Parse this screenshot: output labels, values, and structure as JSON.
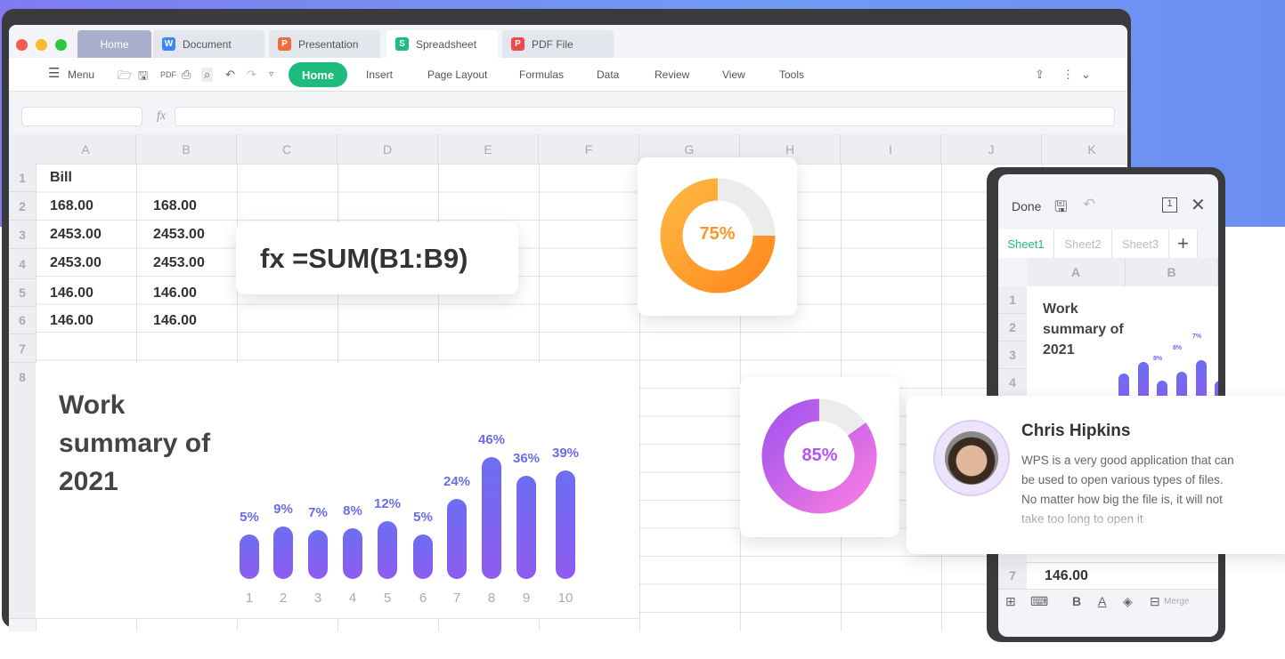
{
  "window": {
    "tabs": [
      {
        "label": "Home",
        "icon": ""
      },
      {
        "label": "Document",
        "icon": "W",
        "color": "#3f86f5"
      },
      {
        "label": "Presentation",
        "icon": "P",
        "color": "#f26b3a"
      },
      {
        "label": "Spreadsheet",
        "icon": "S",
        "color": "#1dbb7c"
      },
      {
        "label": "PDF File",
        "icon": "P",
        "color": "#ef4a4a"
      }
    ],
    "active_tab": "Spreadsheet"
  },
  "toolbar": {
    "menu_label": "Menu",
    "ribbon": [
      "Home",
      "Insert",
      "Page Layout",
      "Formulas",
      "Data",
      "Review",
      "View",
      "Tools"
    ],
    "active": "Home",
    "accent": "#1dbb7c"
  },
  "formula_bar": {
    "fx_label": "fx",
    "name_box": "",
    "value": ""
  },
  "sheet": {
    "columns": [
      "A",
      "B",
      "C",
      "D",
      "E",
      "F",
      "G",
      "H",
      "I",
      "J",
      "K"
    ],
    "rows": [
      "1",
      "2",
      "3",
      "4",
      "5",
      "6",
      "7",
      "8"
    ],
    "cells": [
      [
        "Bill",
        ""
      ],
      [
        "168.00",
        "168.00"
      ],
      [
        "2453.00",
        "2453.00"
      ],
      [
        "2453.00",
        "2453.00"
      ],
      [
        "146.00",
        "146.00"
      ],
      [
        "146.00",
        "146.00"
      ]
    ]
  },
  "formula_card": {
    "text": "fx =SUM(B1:B9)"
  },
  "donuts": [
    {
      "label": "75%",
      "value": 75,
      "colors": [
        "#ffb640",
        "#ff8a1f"
      ]
    },
    {
      "label": "85%",
      "value": 85,
      "colors": [
        "#a455f0",
        "#f77ae0"
      ]
    }
  ],
  "chart_data": {
    "type": "bar",
    "title": "Work summary of 2021",
    "categories": [
      "1",
      "2",
      "3",
      "4",
      "5",
      "6",
      "7",
      "8",
      "9",
      "10"
    ],
    "values": [
      5,
      9,
      7,
      8,
      12,
      5,
      24,
      46,
      36,
      39
    ],
    "labels": [
      "5%",
      "9%",
      "7%",
      "8%",
      "12%",
      "5%",
      "24%",
      "46%",
      "36%",
      "39%"
    ]
  },
  "phone": {
    "done": "Done",
    "sheets": [
      "Sheet1",
      "Sheet2",
      "Sheet3"
    ],
    "active_sheet": "Sheet1",
    "columns": [
      "A",
      "B"
    ],
    "rows": [
      "1",
      "2",
      "3",
      "4",
      "7"
    ],
    "title": "Work summary of 2021",
    "bar_labels": [
      "8%",
      "8%",
      "7%"
    ],
    "cell_row7": "146.00",
    "merge": "Merge"
  },
  "review": {
    "name": "Chris Hipkins",
    "text": "WPS is a very good application that can be used to open various types of files. No matter how big the file is, it will not take too long to open it"
  }
}
